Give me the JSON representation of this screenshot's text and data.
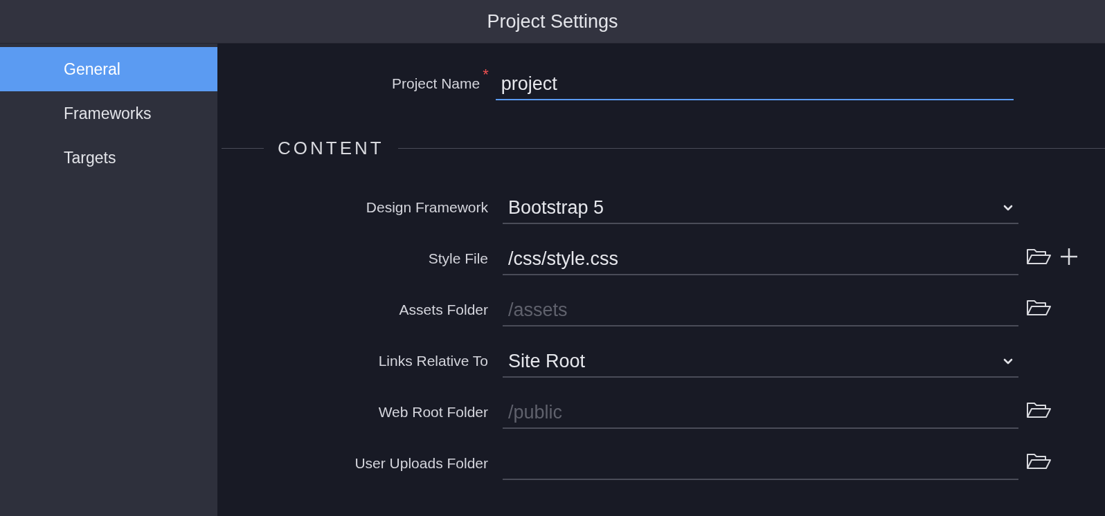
{
  "window": {
    "title": "Project Settings"
  },
  "sidebar": {
    "items": [
      {
        "label": "General",
        "selected": true
      },
      {
        "label": "Frameworks",
        "selected": false
      },
      {
        "label": "Targets",
        "selected": false
      }
    ]
  },
  "project_name": {
    "label": "Project Name",
    "required_mark": "*",
    "value": "project",
    "focused": true
  },
  "section": {
    "title": "CONTENT"
  },
  "fields": [
    {
      "label": "Design Framework",
      "kind": "select",
      "value": "Bootstrap 5",
      "browse_button": false,
      "add_button": false
    },
    {
      "label": "Style File",
      "kind": "file",
      "value": "/css/style.css",
      "browse_button": true,
      "add_button": true
    },
    {
      "label": "Assets Folder",
      "kind": "file",
      "placeholder": "/assets",
      "browse_button": true,
      "add_button": false
    },
    {
      "label": "Links Relative To",
      "kind": "select",
      "value": "Site Root",
      "browse_button": false,
      "add_button": false
    },
    {
      "label": "Web Root Folder",
      "kind": "file",
      "placeholder": "/public",
      "browse_button": true,
      "add_button": false
    },
    {
      "label": "User Uploads Folder",
      "kind": "file",
      "browse_button": true,
      "add_button": false
    }
  ]
}
